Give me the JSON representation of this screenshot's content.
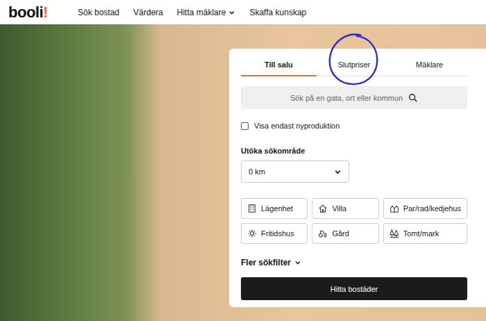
{
  "header": {
    "logo": {
      "text": "booli",
      "mark": "!"
    },
    "nav": [
      {
        "label": "Sök bostad",
        "has_menu": false
      },
      {
        "label": "Värdera",
        "has_menu": false
      },
      {
        "label": "Hitta mäklare",
        "has_menu": true
      },
      {
        "label": "Skaffa kunskap",
        "has_menu": false
      }
    ]
  },
  "tabs": [
    {
      "label": "Till salu",
      "selected": true,
      "circled": false
    },
    {
      "label": "Slutpriser",
      "selected": false,
      "circled": true
    },
    {
      "label": "Mäklare",
      "selected": false,
      "circled": false
    }
  ],
  "search": {
    "placeholder": "Sök på en gata, ort eller kommun"
  },
  "checkbox": {
    "label": "Visa endast nyproduktion",
    "checked": false
  },
  "radius": {
    "label": "Utöka sökområde",
    "value": "0 km"
  },
  "property_types": [
    {
      "label": "Lägenhet",
      "kind": "apartment",
      "selected": false
    },
    {
      "label": "Villa",
      "kind": "house",
      "selected": false
    },
    {
      "label": "Par/rad/kedjehus",
      "kind": "rowhouse",
      "selected": false
    },
    {
      "label": "Fritidshus",
      "kind": "cottage",
      "selected": false
    },
    {
      "label": "Gård",
      "kind": "farm",
      "selected": false
    },
    {
      "label": "Tomt/mark",
      "kind": "land",
      "selected": false
    }
  ],
  "more_filters": {
    "label": "Fler sökfilter"
  },
  "submit": {
    "label": "Hitta bostäder"
  }
}
